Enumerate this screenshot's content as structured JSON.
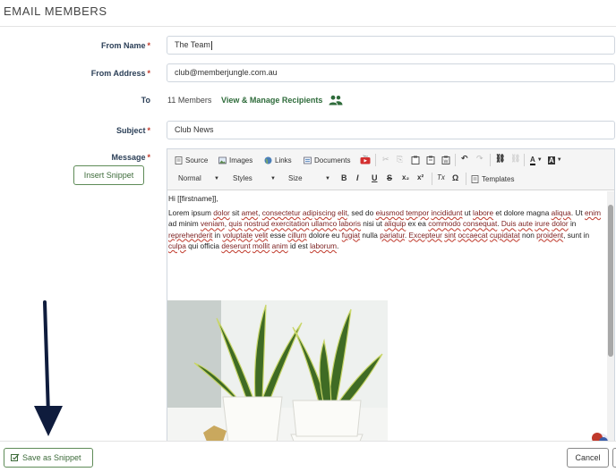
{
  "header": {
    "title": "EMAIL MEMBERS"
  },
  "form": {
    "from_name": {
      "label": "From Name",
      "value": "The Team"
    },
    "from_address": {
      "label": "From Address",
      "value": "club@memberjungle.com.au"
    },
    "to": {
      "label": "To",
      "count": "11 Members",
      "manage_link": "View & Manage Recipients"
    },
    "subject": {
      "label": "Subject",
      "value": "Club News"
    },
    "message": {
      "label": "Message"
    },
    "required_mark": "*",
    "insert_snippet": "Insert Snippet"
  },
  "toolbar": {
    "source": "Source",
    "images": "Images",
    "links": "Links",
    "documents": "Documents",
    "format": "Normal",
    "styles": "Styles",
    "size": "Size",
    "templates": "Templates",
    "bold": "B",
    "italic": "I",
    "underline": "U",
    "strike": "S",
    "subscript": "x₂",
    "superscript": "x²",
    "remove_format": "Tx",
    "special_char": "Ω",
    "text_color": "A",
    "bg_color": "A"
  },
  "content": {
    "greeting": "Hi [[firstname]],",
    "lorem_parts": [
      "Lorem ipsum ",
      "dolor",
      " sit ",
      "amet",
      ", ",
      "consectetur",
      " ",
      "adipiscing",
      " ",
      "elit",
      ", sed do ",
      "eiusmod",
      " ",
      "tempor",
      " ",
      "incididunt",
      " ut ",
      "labore",
      " et dolore magna ",
      "aliqua",
      ". Ut ",
      "enim",
      " ad minim ",
      "veniam",
      ", ",
      "quis",
      " ",
      "nostrud",
      " ",
      "exercitation",
      " ",
      "ullamco",
      " ",
      "laboris",
      " nisi ut ",
      "aliquip",
      " ex ea ",
      "commodo",
      " ",
      "consequat",
      ". ",
      "Duis",
      " ",
      "aute",
      " ",
      "irure",
      " ",
      "dolor",
      " in ",
      "reprehenderit",
      " in ",
      "voluptate",
      " ",
      "velit",
      " esse ",
      "cillum",
      " dolore eu ",
      "fugiat",
      " nulla ",
      "pariatur",
      ". ",
      "Excepteur",
      " ",
      "sint",
      " ",
      "occaecat",
      " ",
      "cupidatat",
      " non ",
      "proident",
      ", sunt in ",
      "culpa",
      " qui officia ",
      "deserunt",
      " ",
      "mollit",
      " ",
      "anim",
      " id est ",
      "laborum",
      "."
    ]
  },
  "footer": {
    "save_snippet": "Save as Snippet",
    "cancel": "Cancel"
  },
  "colors": {
    "accent_green": "#3d6b3a",
    "required_red": "#c0392b",
    "label_navy": "#2b3f57",
    "arrow_navy": "#0f1c3d"
  }
}
